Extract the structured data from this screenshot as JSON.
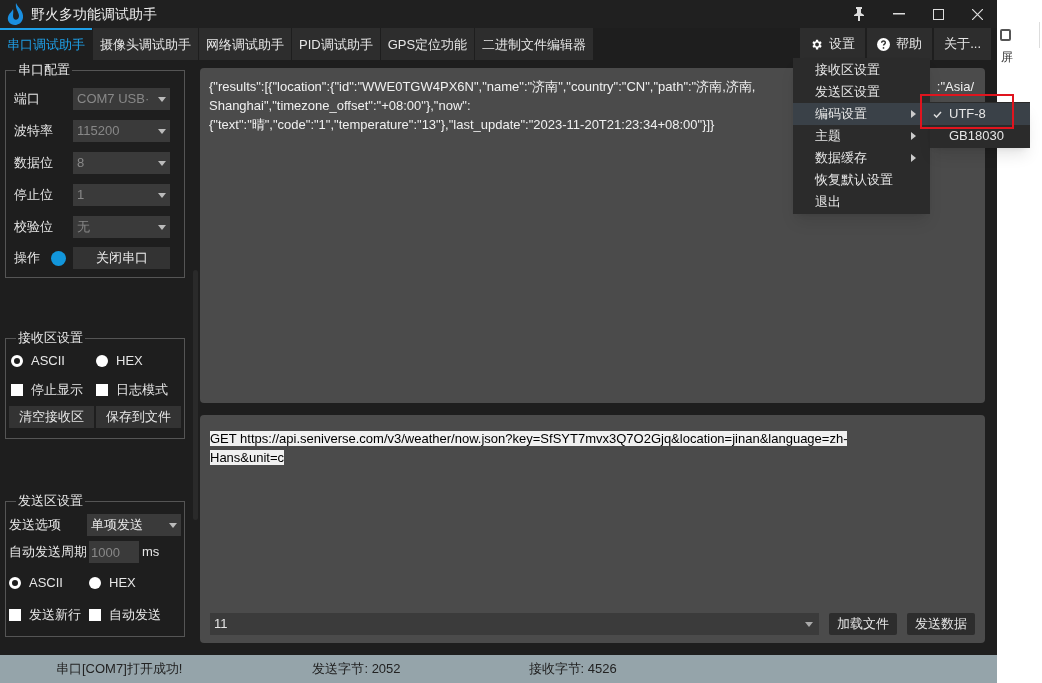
{
  "window": {
    "title": "野火多功能调试助手"
  },
  "tabs": [
    {
      "label": "串口调试助手",
      "selected": true
    },
    {
      "label": "摄像头调试助手",
      "selected": false
    },
    {
      "label": "网络调试助手",
      "selected": false
    },
    {
      "label": "PID调试助手",
      "selected": false
    },
    {
      "label": "GPS定位功能",
      "selected": false
    },
    {
      "label": "二进制文件编辑器",
      "selected": false
    }
  ],
  "header_menus": [
    {
      "label": "设置"
    },
    {
      "label": "帮助"
    },
    {
      "label": "关于..."
    }
  ],
  "serial_config": {
    "title": "串口配置",
    "fields": [
      {
        "label": "端口",
        "value": "COM7 USB·"
      },
      {
        "label": "波特率",
        "value": "115200"
      },
      {
        "label": "数据位",
        "value": "8"
      },
      {
        "label": "停止位",
        "value": "1"
      },
      {
        "label": "校验位",
        "value": "无"
      }
    ],
    "operation": {
      "label": "操作",
      "connected": true,
      "button": "关闭串口"
    }
  },
  "receive_settings": {
    "title": "接收区设置",
    "radios": [
      {
        "label": "ASCII",
        "selected": true
      },
      {
        "label": "HEX",
        "selected": false
      }
    ],
    "checkboxes": [
      {
        "label": "停止显示",
        "checked": false
      },
      {
        "label": "日志模式",
        "checked": false
      }
    ],
    "buttons": [
      "清空接收区",
      "保存到文件"
    ]
  },
  "send_settings": {
    "title": "发送区设置",
    "option_label": "发送选项",
    "option_value": "单项发送",
    "period_label": "自动发送周期",
    "period_value": "1000",
    "period_unit": "ms",
    "radios": [
      {
        "label": "ASCII",
        "selected": true
      },
      {
        "label": "HEX",
        "selected": false
      }
    ],
    "checkboxes": [
      {
        "label": "发送新行",
        "checked": false
      },
      {
        "label": "自动发送",
        "checked": false
      }
    ]
  },
  "receive_area": {
    "lines": [
      {
        "text": "{\"results\":[{\"location\":{\"id\":\"WWE0TGW4PX6N\",\"name\":\"济南\",\"country\":\"CN\",\"path\":\"济南,济南,",
        "tail": ":\"Asia/"
      },
      {
        "text": "Shanghai\",\"timezone_offset\":\"+08:00\"},\"now\":"
      },
      {
        "text": "{\"text\":\"晴\",\"code\":\"1\",\"temperature\":\"13\"},\"last_update\":\"2023-11-20T21:23:34+08:00\"}]}"
      }
    ]
  },
  "send_area": {
    "text": "GET https://api.seniverse.com/v3/weather/now.json?key=SfSYT7mvx3Q7O2Gjq&location=jinan&language=zh-Hans&unit=c",
    "selected": true,
    "history_value": "11",
    "buttons": [
      "加载文件",
      "发送数据"
    ]
  },
  "status_bar": [
    "串口[COM7]打开成功!",
    "发送字节: 2052",
    "接收字节: 4526"
  ],
  "settings_menu": {
    "items": [
      {
        "label": "接收区设置",
        "submenu": false,
        "selected": false
      },
      {
        "label": "发送区设置",
        "submenu": false,
        "selected": false
      },
      {
        "label": "编码设置",
        "submenu": true,
        "selected": true
      },
      {
        "label": "主题",
        "submenu": true,
        "selected": false
      },
      {
        "label": "数据缓存",
        "submenu": true,
        "selected": false
      },
      {
        "label": "恢复默认设置",
        "submenu": false,
        "selected": false
      },
      {
        "label": "退出",
        "submenu": false,
        "selected": false
      }
    ],
    "submenu": [
      {
        "label": "UTF-8",
        "checked": true,
        "selected": true,
        "annotated": true
      },
      {
        "label": "GB18030",
        "checked": false,
        "selected": false,
        "annotated": false
      }
    ]
  },
  "background_window": {
    "text": "屏"
  }
}
